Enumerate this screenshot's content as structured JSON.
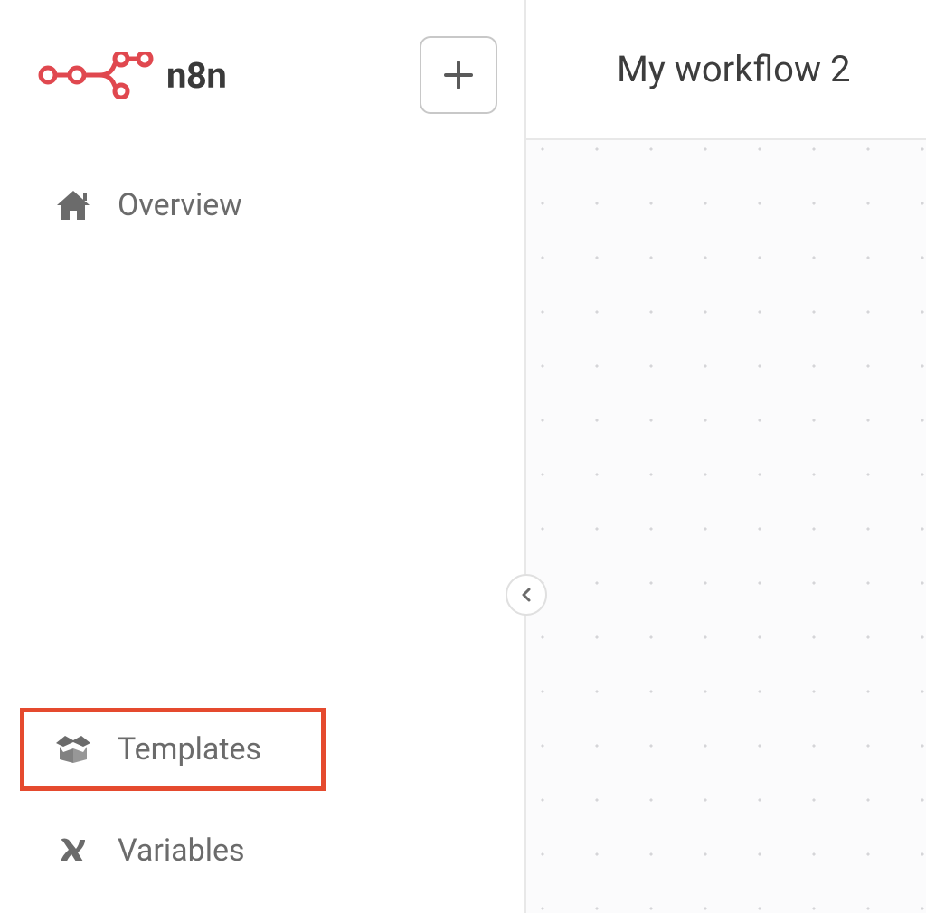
{
  "brand": {
    "name": "n8n",
    "accent_color": "#e0484f"
  },
  "sidebar": {
    "items": [
      {
        "id": "overview",
        "label": "Overview",
        "icon": "home-icon",
        "highlighted": false
      },
      {
        "id": "templates",
        "label": "Templates",
        "icon": "box-open-icon",
        "highlighted": true
      },
      {
        "id": "variables",
        "label": "Variables",
        "icon": "variable-x-icon",
        "highlighted": false
      }
    ],
    "add_button": {
      "label": "+"
    }
  },
  "header": {
    "workflow_title": "My workflow 2"
  },
  "canvas": {
    "background": "dotted-grid"
  },
  "colors": {
    "accent": "#e0484f",
    "highlight_box": "#e54a2e",
    "text_primary": "#3a3a3a",
    "text_secondary": "#6b6b6b",
    "border": "#e8e8e8"
  }
}
